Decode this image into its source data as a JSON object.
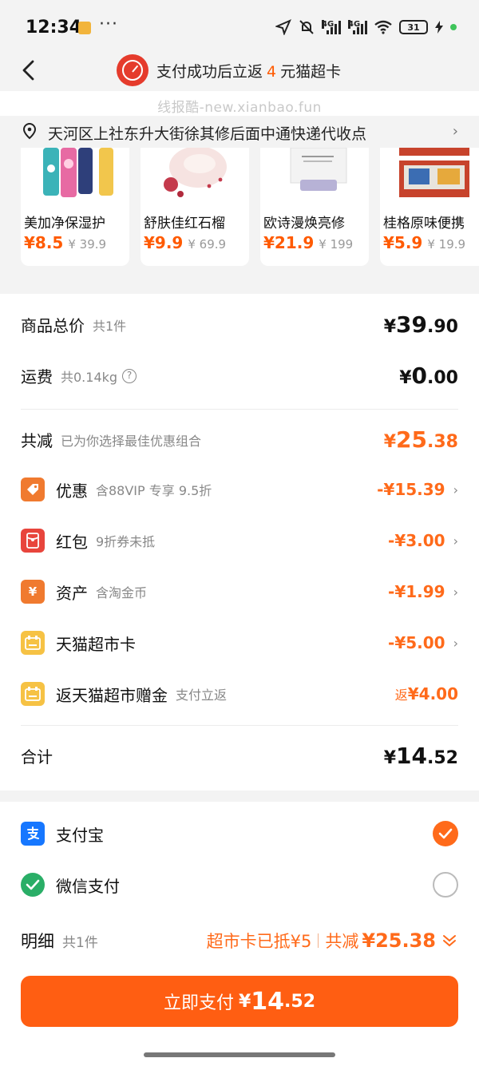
{
  "status": {
    "time": "12:34",
    "network1": "4G",
    "network2": "4G",
    "battery": "31"
  },
  "header": {
    "promo_prefix": "支付成功后立返",
    "promo_amount": "4",
    "promo_suffix": "元猫超卡"
  },
  "watermark": "线报酷-new.xianbao.fun",
  "address": {
    "text": "天河区上社东升大街徐其修后面中通快递代收点"
  },
  "recommendations": [
    {
      "name": "美加净保湿护",
      "price": "¥8.5",
      "original": "¥ 39.9"
    },
    {
      "name": "舒肤佳红石榴",
      "price": "¥9.9",
      "original": "¥ 69.9"
    },
    {
      "name": "欧诗漫焕亮修",
      "price": "¥21.9",
      "original": "¥ 199"
    },
    {
      "name": "桂格原味便携",
      "price": "¥5.9",
      "original": "¥ 19.9"
    }
  ],
  "summary": {
    "goods_total": {
      "label": "商品总价",
      "sub": "共1件",
      "sym": "¥",
      "int": "39",
      "dec": ".90"
    },
    "shipping": {
      "label": "运费",
      "sub": "共0.14kg",
      "sym": "¥",
      "int": "0",
      "dec": ".00"
    },
    "discount": {
      "label": "共减",
      "sub": "已为你选择最佳优惠组合",
      "sym": "¥",
      "int": "25",
      "dec": ".38"
    },
    "items": [
      {
        "label": "优惠",
        "sub": "含88VIP 专享 9.5折",
        "amount": "-¥15.39",
        "color": "#f07a2f"
      },
      {
        "label": "红包",
        "sub": "9折券未抵",
        "amount": "-¥3.00",
        "color": "#e8453c"
      },
      {
        "label": "资产",
        "sub": "含淘金币",
        "amount": "-¥1.99",
        "color": "#f07a2f"
      },
      {
        "label": "天猫超市卡",
        "sub": "",
        "amount": "-¥5.00",
        "color": "#f6c244"
      },
      {
        "label": "返天猫超市赠金",
        "sub": "支付立返",
        "amount_prefix": "返",
        "amount": "¥4.00",
        "color": "#f6c244"
      }
    ],
    "total": {
      "label": "合计",
      "sym": "¥",
      "int": "14",
      "dec": ".52"
    }
  },
  "payment": {
    "methods": [
      {
        "label": "支付宝",
        "selected": true,
        "color": "#1677ff"
      },
      {
        "label": "微信支付",
        "selected": false,
        "color": "#2aae67"
      }
    ]
  },
  "detail": {
    "label": "明细",
    "sub": "共1件",
    "card_text": "超市卡已抵¥5",
    "saved_label": "共减",
    "saved_amount": "¥25.38"
  },
  "pay_button": {
    "label": "立即支付",
    "sym": "¥",
    "int": "14",
    "dec": ".52"
  }
}
